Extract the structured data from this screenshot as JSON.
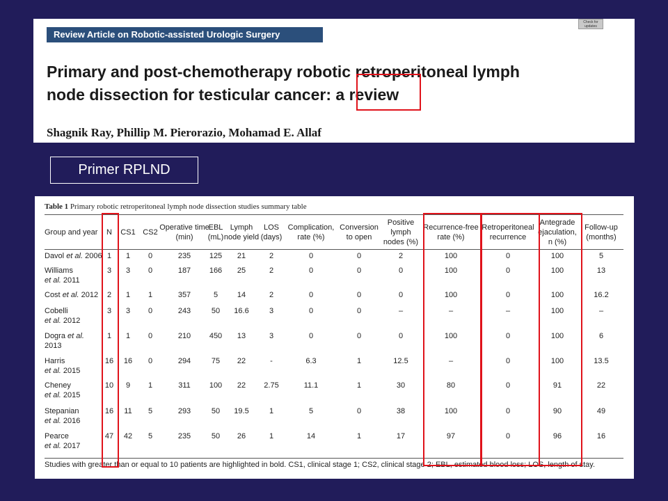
{
  "header": {
    "article_label": "Review Article on Robotic-assisted Urologic Surgery",
    "check_badge": "Check for updates",
    "title_line1": "Primary and post-chemotherapy robotic retroperitoneal lymph",
    "title_line2": "node dissection for testicular cancer: a review",
    "authors": "Shagnik Ray, Phillip M. Pierorazio, Mohamad E. Allaf"
  },
  "primer_label": "Primer RPLND",
  "table": {
    "caption_bold": "Table 1",
    "caption_text": " Primary robotic retroperitoneal lymph node dissection studies summary table",
    "columns": [
      "Group and year",
      "N",
      "CS1",
      "CS2",
      "Operative time (min)",
      "EBL (mL)",
      "Lymph node yield",
      "LOS (days)",
      "Complication, rate (%)",
      "Conversion to open",
      "Positive lymph nodes (%)",
      "Recurrence-free rate (%)",
      "Retroperitoneal recurrence",
      "Antegrade ejaculation, n (%)",
      "Follow-up (months)"
    ],
    "rows": [
      [
        "Davol et al. 2006",
        "1",
        "1",
        "0",
        "235",
        "125",
        "21",
        "2",
        "0",
        "0",
        "2",
        "100",
        "0",
        "100",
        "5"
      ],
      [
        "Williams et al. 2011",
        "3",
        "3",
        "0",
        "187",
        "166",
        "25",
        "2",
        "0",
        "0",
        "0",
        "100",
        "0",
        "100",
        "13"
      ],
      [
        "Cost et al. 2012",
        "2",
        "1",
        "1",
        "357",
        "5",
        "14",
        "2",
        "0",
        "0",
        "0",
        "100",
        "0",
        "100",
        "16.2"
      ],
      [
        "Cobelli et al. 2012",
        "3",
        "3",
        "0",
        "243",
        "50",
        "16.6",
        "3",
        "0",
        "0",
        "–",
        "–",
        "–",
        "100",
        "–"
      ],
      [
        "Dogra et al. 2013",
        "1",
        "1",
        "0",
        "210",
        "450",
        "13",
        "3",
        "0",
        "0",
        "0",
        "100",
        "0",
        "100",
        "6"
      ],
      [
        "Harris et al. 2015",
        "16",
        "16",
        "0",
        "294",
        "75",
        "22",
        "-",
        "6.3",
        "1",
        "12.5",
        "–",
        "0",
        "100",
        "13.5"
      ],
      [
        "Cheney et al. 2015",
        "10",
        "9",
        "1",
        "311",
        "100",
        "22",
        "2.75",
        "11.1",
        "1",
        "30",
        "80",
        "0",
        "91",
        "22"
      ],
      [
        "Stepanian et al. 2016",
        "16",
        "11",
        "5",
        "293",
        "50",
        "19.5",
        "1",
        "5",
        "0",
        "38",
        "100",
        "0",
        "90",
        "49"
      ],
      [
        "Pearce et al. 2017",
        "47",
        "42",
        "5",
        "235",
        "50",
        "26",
        "1",
        "14",
        "1",
        "17",
        "97",
        "0",
        "96",
        "16"
      ]
    ],
    "footnote": "Studies with greater than or equal to 10 patients are highlighted in bold. CS1, clinical stage 1; CS2, clinical stage 2; EBL, estimated blood loss; LOS, length of stay."
  },
  "colors": {
    "background": "#211c5a",
    "label_bar": "#2b4f7b",
    "highlight_box": "#e0121a"
  }
}
